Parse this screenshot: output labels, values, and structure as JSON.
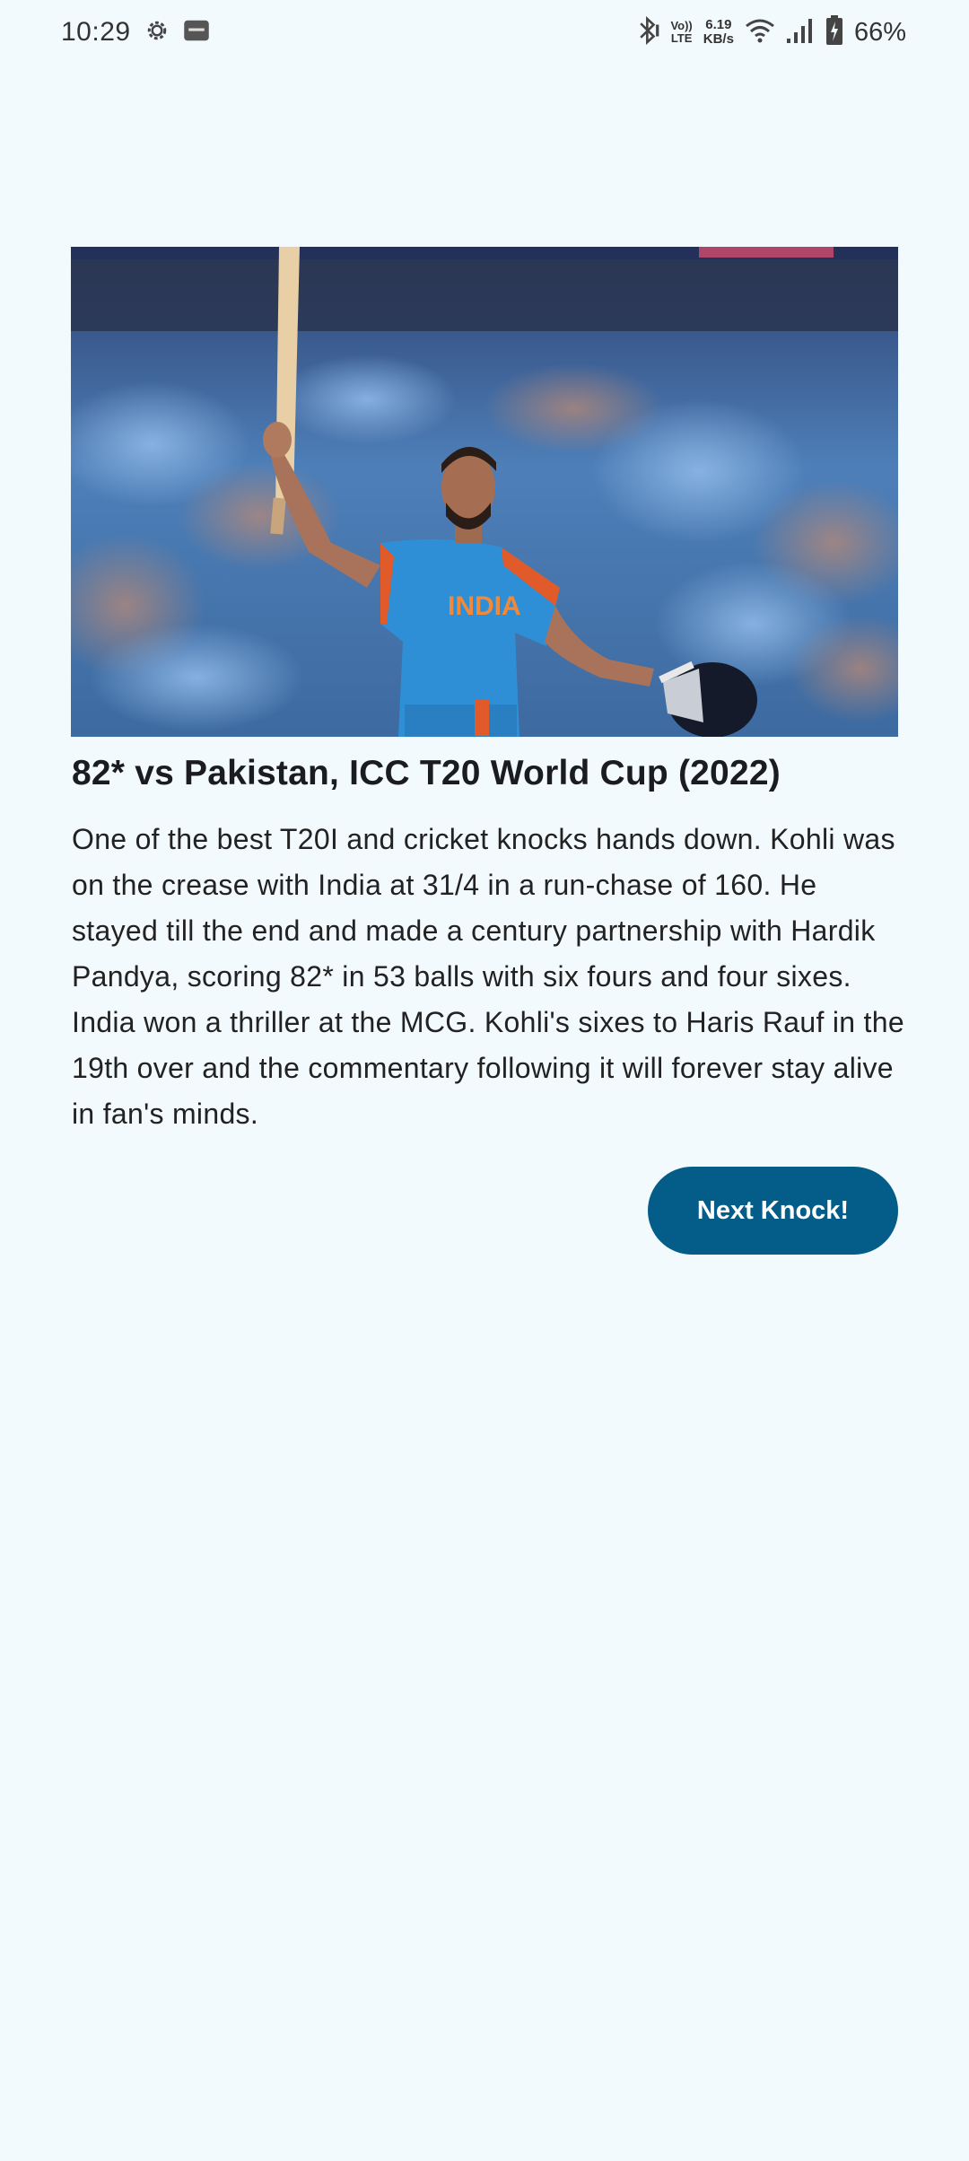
{
  "status_bar": {
    "time": "10:29",
    "net_speed_value": "6.19",
    "net_speed_unit": "KB/s",
    "volte_top": "Vo))",
    "volte_bottom": "LTE",
    "battery_percent": "66%",
    "icons": [
      "settings-gear-icon",
      "notification-app-icon",
      "bluetooth-icon",
      "volte-icon",
      "wifi-icon",
      "signal-icon",
      "battery-charging-icon"
    ]
  },
  "knock": {
    "image_subject": "player-celebrating-photo",
    "title": "82* vs Pakistan, ICC T20 World Cup (2022)",
    "description": "One of the best T20I and cricket knocks hands down. Kohli was on the crease with India at 31/4 in a run-chase of 160. He stayed till the end and made a century partnership with Hardik Pandya, scoring 82* in 53 balls with six fours and four sixes. India won a thriller at the MCG. Kohli's sixes to Haris Rauf in the 19th over and the commentary following it will forever stay alive in fan's minds.",
    "jersey_text": "INDIA"
  },
  "actions": {
    "next_label": "Next Knock!"
  },
  "colors": {
    "background": "#f3fafd",
    "button": "#045d88",
    "button_text": "#ffffff",
    "jersey": "#2f8fd6"
  }
}
